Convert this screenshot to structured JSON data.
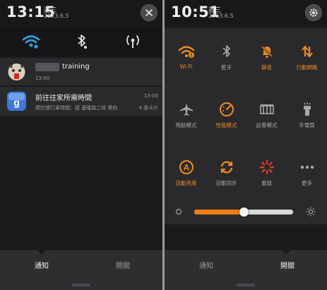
{
  "left": {
    "time": "13:15",
    "weekday": "週三",
    "date": "2013.6.5",
    "notifications": [
      {
        "title": "training",
        "time_line": "13:00"
      },
      {
        "title": "前往往家所需時間",
        "time": "13:05",
        "detail": "預計總行車時間：經 基隆路二段 需約",
        "meta": "4 張卡片"
      }
    ],
    "tabs": {
      "notify": "通知",
      "switch": "開關"
    }
  },
  "right": {
    "time": "10:51",
    "weekday": "週三",
    "date": "2013.6.5",
    "toggles": [
      {
        "label": "Wi-Fi",
        "icon": "wifi-alert-icon",
        "active": true
      },
      {
        "label": "藍牙",
        "icon": "bluetooth-icon",
        "active": false
      },
      {
        "label": "靜音",
        "icon": "mute-bell-icon",
        "active": true
      },
      {
        "label": "行動網路",
        "icon": "mobile-data-icon",
        "active": true
      },
      {
        "label": "飛航模式",
        "icon": "airplane-icon",
        "active": false
      },
      {
        "label": "性能模式",
        "icon": "performance-icon",
        "active": true
      },
      {
        "label": "訪客模式",
        "icon": "guest-mode-icon",
        "active": false
      },
      {
        "label": "手電筒",
        "icon": "flashlight-icon",
        "active": false
      },
      {
        "label": "自動亮度",
        "icon": "auto-brightness-icon",
        "active": true
      },
      {
        "label": "自動同步",
        "icon": "sync-icon",
        "active": false
      },
      {
        "label": "重啟",
        "icon": "reboot-icon",
        "active": false
      },
      {
        "label": "更多",
        "icon": "more-icon",
        "active": false
      }
    ],
    "brightness": 0.5,
    "tabs": {
      "notify": "通知",
      "switch": "開關"
    }
  },
  "colors": {
    "accent": "#f08a1c",
    "background": "#1b1b1d",
    "wifi_blue": "#2aa6e6"
  }
}
